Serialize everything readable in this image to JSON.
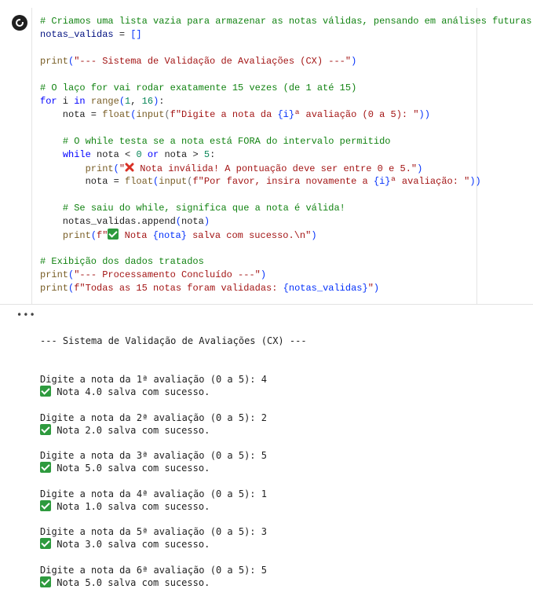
{
  "cell": {
    "run_button_label": "Run cell",
    "code_lines": [
      [
        {
          "t": "# Criamos uma lista vazia para armazenar as notas válidas, pensando em análises futuras",
          "c": "c-com"
        }
      ],
      [
        {
          "t": "notas_validas",
          "c": "c-var"
        },
        {
          "t": " = "
        },
        {
          "t": "[]",
          "c": "c-b"
        }
      ],
      [],
      [
        {
          "t": "print",
          "c": "c-fn"
        },
        {
          "t": "(",
          "c": "c-b"
        },
        {
          "t": "\"--- Sistema de Validação de Avaliações (CX) ---\"",
          "c": "c-str"
        },
        {
          "t": ")",
          "c": "c-b"
        }
      ],
      [],
      [
        {
          "t": "# O laço for vai rodar exatamente 15 vezes (de 1 até 15)",
          "c": "c-com"
        }
      ],
      [
        {
          "t": "for",
          "c": "c-kw"
        },
        {
          "t": " i "
        },
        {
          "t": "in",
          "c": "c-kw"
        },
        {
          "t": " "
        },
        {
          "t": "range",
          "c": "c-fn"
        },
        {
          "t": "(",
          "c": "c-b"
        },
        {
          "t": "1",
          "c": "c-num"
        },
        {
          "t": ", "
        },
        {
          "t": "16",
          "c": "c-num"
        },
        {
          "t": ")",
          "c": "c-b"
        },
        {
          "t": ":"
        }
      ],
      [
        {
          "t": "    nota = "
        },
        {
          "t": "float",
          "c": "c-fn"
        },
        {
          "t": "(",
          "c": "c-b"
        },
        {
          "t": "input",
          "c": "c-fn"
        },
        {
          "t": "(",
          "c": "c-p"
        },
        {
          "t": "f\"Digite a nota da ",
          "c": "c-str"
        },
        {
          "t": "{i}",
          "c": "c-b"
        },
        {
          "t": "ª avaliação (0 a 5): \"",
          "c": "c-str"
        },
        {
          "t": "))",
          "c": "c-b"
        }
      ],
      [],
      [
        {
          "t": "    "
        },
        {
          "t": "# O while testa se a nota está FORA do intervalo permitido",
          "c": "c-com"
        }
      ],
      [
        {
          "t": "    "
        },
        {
          "t": "while",
          "c": "c-kw"
        },
        {
          "t": " nota < "
        },
        {
          "t": "0",
          "c": "c-num"
        },
        {
          "t": " "
        },
        {
          "t": "or",
          "c": "c-kw"
        },
        {
          "t": " nota > "
        },
        {
          "t": "5",
          "c": "c-num"
        },
        {
          "t": ":"
        }
      ],
      [
        {
          "t": "        "
        },
        {
          "t": "print",
          "c": "c-fn"
        },
        {
          "t": "(",
          "c": "c-b"
        },
        {
          "t": "\"",
          "c": "c-str"
        },
        {
          "e": "x"
        },
        {
          "t": " Nota inválida! A pontuação deve ser entre 0 e 5.\"",
          "c": "c-str"
        },
        {
          "t": ")",
          "c": "c-b"
        }
      ],
      [
        {
          "t": "        nota = "
        },
        {
          "t": "float",
          "c": "c-fn"
        },
        {
          "t": "(",
          "c": "c-b"
        },
        {
          "t": "input",
          "c": "c-fn"
        },
        {
          "t": "(",
          "c": "c-p"
        },
        {
          "t": "f\"Por favor, insira novamente a ",
          "c": "c-str"
        },
        {
          "t": "{i}",
          "c": "c-b"
        },
        {
          "t": "ª avaliação: \"",
          "c": "c-str"
        },
        {
          "t": "))",
          "c": "c-b"
        }
      ],
      [],
      [
        {
          "t": "    "
        },
        {
          "t": "# Se saiu do while, significa que a nota é válida!",
          "c": "c-com"
        }
      ],
      [
        {
          "t": "    notas_validas.append"
        },
        {
          "t": "(",
          "c": "c-b"
        },
        {
          "t": "nota"
        },
        {
          "t": ")",
          "c": "c-b"
        }
      ],
      [
        {
          "t": "    "
        },
        {
          "t": "print",
          "c": "c-fn"
        },
        {
          "t": "(",
          "c": "c-b"
        },
        {
          "t": "f\"",
          "c": "c-str"
        },
        {
          "e": "check"
        },
        {
          "t": " Nota ",
          "c": "c-str"
        },
        {
          "t": "{nota}",
          "c": "c-b"
        },
        {
          "t": " salva com sucesso.\\n\"",
          "c": "c-str"
        },
        {
          "t": ")",
          "c": "c-b"
        }
      ],
      [],
      [
        {
          "t": "# Exibição dos dados tratados",
          "c": "c-com"
        }
      ],
      [
        {
          "t": "print",
          "c": "c-fn"
        },
        {
          "t": "(",
          "c": "c-b"
        },
        {
          "t": "\"--- Processamento Concluído ---\"",
          "c": "c-str"
        },
        {
          "t": ")",
          "c": "c-b"
        }
      ],
      [
        {
          "t": "print",
          "c": "c-fn"
        },
        {
          "t": "(",
          "c": "c-b"
        },
        {
          "t": "f\"Todas as 15 notas foram validadas: ",
          "c": "c-str"
        },
        {
          "t": "{notas_validas}",
          "c": "c-b"
        },
        {
          "t": "\"",
          "c": "c-str"
        },
        {
          "t": ")",
          "c": "c-b"
        }
      ]
    ]
  },
  "output": {
    "menu_label": "•••",
    "header": "--- Sistema de Validação de Avaliações (CX) ---",
    "entries": [
      {
        "prompt": "Digite a nota da 1ª avaliação (0 a 5): 4",
        "result": "Nota 4.0 salva com sucesso."
      },
      {
        "prompt": "Digite a nota da 2ª avaliação (0 a 5): 2",
        "result": "Nota 2.0 salva com sucesso."
      },
      {
        "prompt": "Digite a nota da 3ª avaliação (0 a 5): 5",
        "result": "Nota 5.0 salva com sucesso."
      },
      {
        "prompt": "Digite a nota da 4ª avaliação (0 a 5): 1",
        "result": "Nota 1.0 salva com sucesso."
      },
      {
        "prompt": "Digite a nota da 5ª avaliação (0 a 5): 3",
        "result": "Nota 3.0 salva com sucesso."
      },
      {
        "prompt": "Digite a nota da 6ª avaliação (0 a 5): 5",
        "result": "Nota 5.0 salva com sucesso."
      }
    ]
  }
}
